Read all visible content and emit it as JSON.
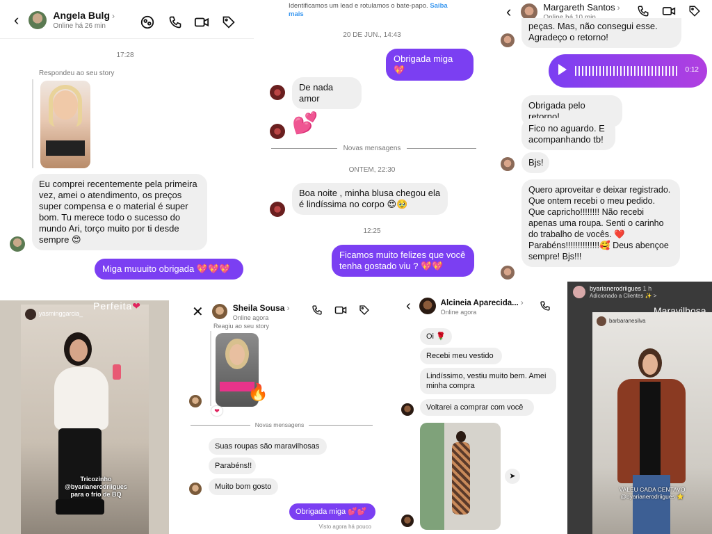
{
  "p1": {
    "contact_name": "Angela Bulg",
    "status": "Online há 26 min",
    "time": "17:28",
    "story_reply_label": "Respondeu ao seu story",
    "message_in": "Eu comprei recentemente pela primeira vez, amei o atendimento, os preços super compensa e o material é super bom. Tu merece todo o sucesso do mundo Ari, torço muito por ti desde sempre 😍",
    "message_out": "Miga muuuito obrigada 💖💖💖"
  },
  "p2": {
    "banner": "Identificamos um lead e rotulamos o bate-papo.",
    "banner_link": "Saiba mais",
    "date1": "20 DE JUN., 14:43",
    "out1": "Obrigada miga 💖",
    "in1": "De nada amor",
    "emoji": "💕",
    "new_messages": "Novas mensagens",
    "date2": "ONTEM, 22:30",
    "in2": "Boa noite , minha blusa chegou ela é lindíssima no corpo 😍🥹",
    "time3": "12:25",
    "out2": "Ficamos muito felizes que você tenha gostado viu ? 💖💖"
  },
  "p3": {
    "contact_name": "Margareth Santos",
    "status": "Online há 10 min",
    "top_in": "peças.  Mas, não consegui esse. Agradeço o retorno!",
    "audio_duration": "0:12",
    "in1": "Obrigada pelo retorno!",
    "in2": "Fico no aguardo. E acompanhando tb!",
    "in3": "Bjs!",
    "in4": "Quero aproveitar e deixar registrado. Que ontem recebi o meu pedido. Que capricho!!!!!!!! Não recebi apenas uma roupa.  Senti o carinho do trabalho de vocês. ❤️ Parabéns!!!!!!!!!!!!!!🥰 Deus abençoe sempre! Bjs!!!"
  },
  "p4": {
    "username": "yasminggarcia_",
    "title": "Perfeita",
    "caption1": "Tricozinho @byarianerodriigues",
    "caption2": "para o frio de BQ"
  },
  "p5": {
    "contact_name": "Sheila Sousa",
    "status": "Online agora",
    "story_reply_label": "Reagiu ao seu story",
    "reaction": "🔥",
    "new_messages": "Novas mensagens",
    "in1": "Suas roupas são  maravilhosas",
    "in2": "Parabéns!!",
    "in3": "Muito bom gosto",
    "out1": "Obrigada miga 💕💕",
    "seen": "Visto agora há pouco"
  },
  "p6": {
    "contact_name": "Alcineia Aparecida...",
    "status": "Online agora",
    "in1": "Oi 🌹",
    "in2": "Recebi meu vestido",
    "in3": "Lindíssimo, vestiu muito bem. Amei minha compra",
    "in4": "Voltarei a comprar com você"
  },
  "p7": {
    "username": "byarianerodriigues",
    "time": "1 h",
    "added": "Adicionado a Clientes ✨ >",
    "title": "Maravilhosa",
    "inner_user": "barbaranesilva",
    "caption1": "VALEU CADA CENTAVO",
    "caption2": "@byarianerodriigues ⭐"
  },
  "colors": {
    "accent": "#7b3ff2",
    "bubble_in": "#efefef"
  }
}
